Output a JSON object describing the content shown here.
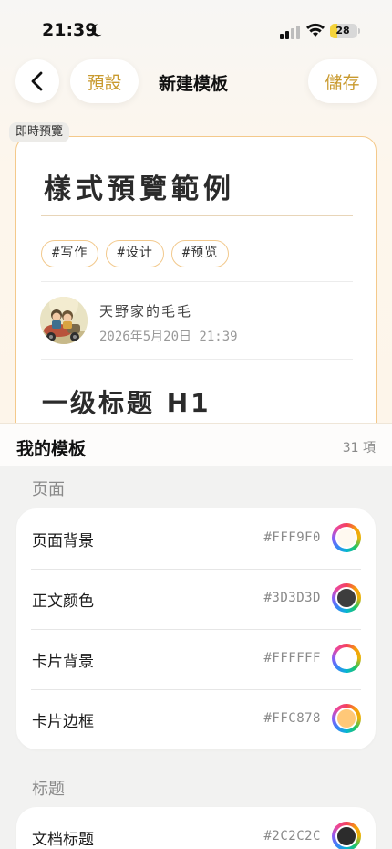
{
  "status_bar": {
    "time": "21:39",
    "battery": "28",
    "battery_level": 0.28
  },
  "nav": {
    "preset_label": "預設",
    "title": "新建模板",
    "save_label": "儲存"
  },
  "preview": {
    "tag": "即時預覽",
    "heading": "樣式預覽範例",
    "tags": [
      "#写作",
      "#设计",
      "#预览"
    ],
    "author_name": "天野家的毛毛",
    "date": "2026年5月20日 21:39",
    "h1": "一级标题 H1"
  },
  "sheet": {
    "title": "我的模板",
    "count": "31 項"
  },
  "sections": [
    {
      "title": "页面",
      "rows": [
        {
          "label": "页面背景",
          "hex": "#FFF9F0",
          "color": "#FFF9F0"
        },
        {
          "label": "正文颜色",
          "hex": "#3D3D3D",
          "color": "#3D3D3D"
        },
        {
          "label": "卡片背景",
          "hex": "#FFFFFF",
          "color": "#FFFFFF"
        },
        {
          "label": "卡片边框",
          "hex": "#FFC878",
          "color": "#FFC878"
        }
      ]
    },
    {
      "title": "标题",
      "rows": [
        {
          "label": "文档标题",
          "hex": "#2C2C2C",
          "color": "#2C2C2C"
        }
      ]
    }
  ],
  "colors": {
    "accent": "#c99a2e",
    "card_border": "#f4c98b"
  }
}
